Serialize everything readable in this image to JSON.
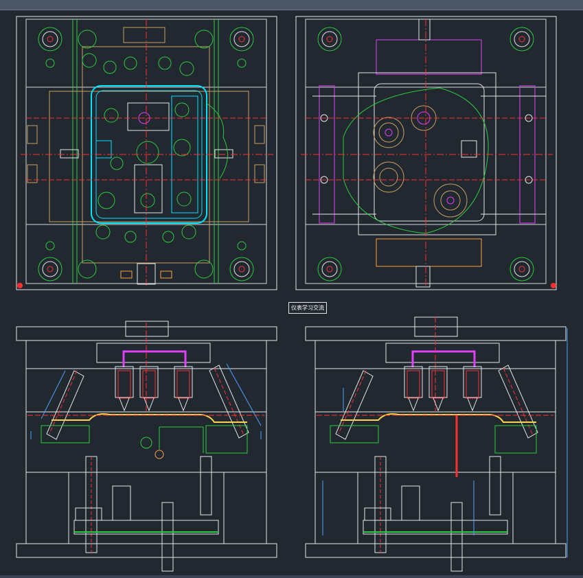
{
  "app": {
    "background": "#212830"
  },
  "drawing": {
    "center_label": "仪表学习交流",
    "colors": {
      "frame": "#e6e6e6",
      "centerline": "#ff3030",
      "green": "#2ecc40",
      "cyan": "#00e5ff",
      "magenta": "#e040fb",
      "yellow": "#ffd54f",
      "orange": "#ff9f40",
      "blue": "#4aa3ff",
      "lime": "#9cff57"
    },
    "views": [
      {
        "id": "top-left-plan",
        "kind": "plan"
      },
      {
        "id": "top-right-plan",
        "kind": "plan"
      },
      {
        "id": "bottom-left-section",
        "kind": "section"
      },
      {
        "id": "bottom-right-section",
        "kind": "section"
      }
    ]
  }
}
